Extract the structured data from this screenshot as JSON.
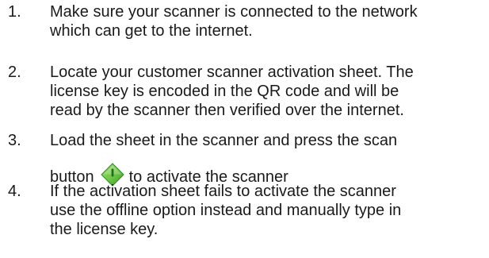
{
  "steps": [
    {
      "number": "1.",
      "lines": [
        "Make sure your scanner is connected to the network",
        "which can get to the internet."
      ]
    },
    {
      "number": "2.",
      "lines": [
        "Locate your customer scanner activation sheet. The",
        "license key is encoded in the QR code and will be",
        "read by the scanner then verified over the internet."
      ]
    },
    {
      "number": "3.",
      "line1": "Load the sheet in the scanner and press the scan",
      "line2_before": "button",
      "icon": "scan-button-icon",
      "line2_after": "to activate the scanner"
    },
    {
      "number": "4.",
      "lines": [
        "If the activation sheet fails to activate the scanner",
        "use the offline option instead and manually type in",
        "the license key."
      ]
    }
  ],
  "colors": {
    "text": "#1a1a1a",
    "icon_green_light": "#8dd25a",
    "icon_green_dark": "#3f9a2c",
    "icon_mark": "#1f6f1a"
  }
}
